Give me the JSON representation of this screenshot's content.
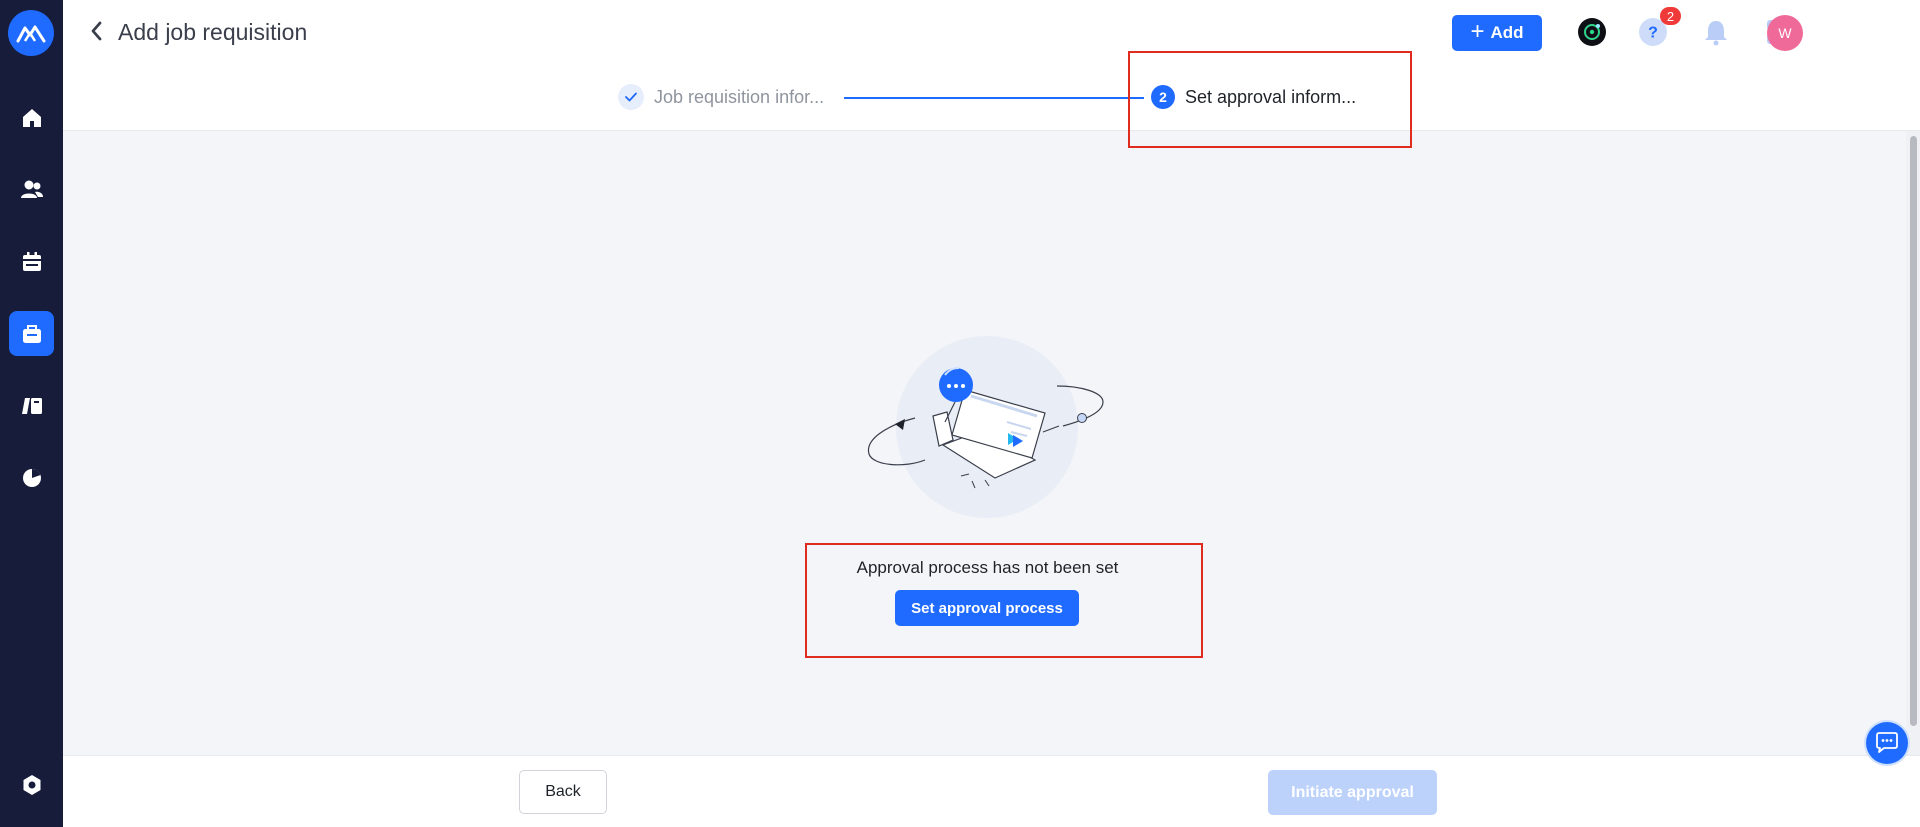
{
  "header": {
    "title": "Add job requisition",
    "add_label": "Add",
    "notification_count": "2",
    "avatar_initial": "W"
  },
  "stepper": {
    "steps": [
      {
        "label": "Job requisition infor...",
        "status": "completed"
      },
      {
        "number": "2",
        "label": "Set approval inform...",
        "status": "active"
      }
    ]
  },
  "empty_state": {
    "message": "Approval process has not been set",
    "action_label": "Set approval process"
  },
  "footer": {
    "back_label": "Back",
    "initiate_label": "Initiate approval"
  },
  "sidebar": {
    "items": [
      {
        "icon": "home-icon",
        "active": false
      },
      {
        "icon": "people-icon",
        "active": false
      },
      {
        "icon": "calendar-icon",
        "active": false
      },
      {
        "icon": "briefcase-icon",
        "active": true
      },
      {
        "icon": "book-icon",
        "active": false
      },
      {
        "icon": "pie-chart-icon",
        "active": false
      }
    ]
  },
  "colors": {
    "primary": "#1f6bff",
    "sidebar_bg": "#161c3a",
    "badge": "#f03a3a",
    "avatar": "#ef6a98",
    "annotation": "#e02b1f",
    "disabled_button": "#bcd2fb"
  }
}
